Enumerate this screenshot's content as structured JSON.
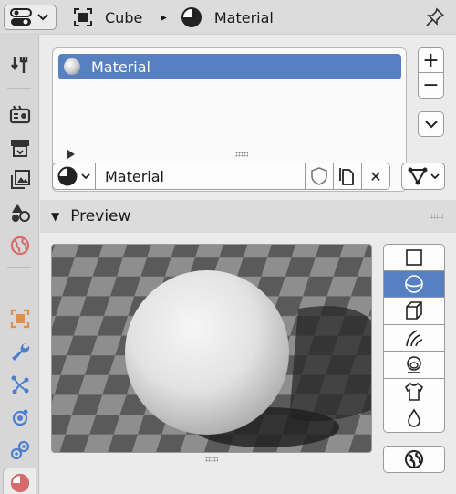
{
  "header": {
    "object_name": "Cube",
    "material_name": "Material",
    "separator_glyph": "▸"
  },
  "slots": {
    "items": [
      {
        "label": "Material"
      }
    ],
    "add_glyph": "+",
    "remove_glyph": "−"
  },
  "material": {
    "datablock_name": "Material",
    "unlink_glyph": "✕"
  },
  "preview_panel": {
    "title": "Preview",
    "toggle_glyph": "▼"
  },
  "colors": {
    "accent": "#5680c2",
    "material_tab": "#d66b6b",
    "object_tab": "#e0904a",
    "blue_tab": "#4d7fcf"
  }
}
